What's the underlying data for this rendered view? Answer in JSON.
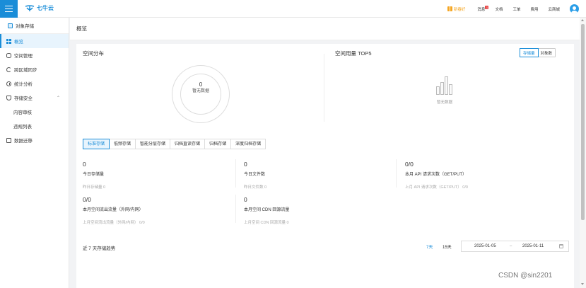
{
  "brand": {
    "name": "七牛云",
    "color": "#1a8dd8"
  },
  "topbar": {
    "promo_label": "新春好",
    "links": [
      {
        "label": "消息",
        "badge": "1"
      },
      {
        "label": "文档"
      },
      {
        "label": "工单"
      },
      {
        "label": "费用"
      },
      {
        "label": "云商城"
      }
    ]
  },
  "sidebar": {
    "header": "对象存储",
    "items": [
      {
        "label": "概览",
        "icon": "grid-icon",
        "active": true
      },
      {
        "label": "空间管理",
        "icon": "database-icon"
      },
      {
        "label": "跨区域同步",
        "icon": "sync-icon"
      },
      {
        "label": "统计分析",
        "icon": "clock-icon"
      },
      {
        "label": "存储安全",
        "icon": "shield-icon",
        "expanded": true
      },
      {
        "label": "内容审核",
        "sub": true
      },
      {
        "label": "违规列表",
        "sub": true
      },
      {
        "label": "数据迁移",
        "icon": "migrate-icon"
      }
    ]
  },
  "page": {
    "title": "概览"
  },
  "space_distribution": {
    "title": "空间分布",
    "value": "0",
    "empty_text": "暂无数据"
  },
  "top5": {
    "title": "空间用量 TOP5",
    "toggle": [
      "存储量",
      "对象数"
    ],
    "empty_text": "暂无数据"
  },
  "storage_tabs": [
    "标准存储",
    "低频存储",
    "智能分层存储",
    "归档直读存储",
    "归档存储",
    "深度归档存储"
  ],
  "stats": [
    {
      "value": "0",
      "label": "今日存储量",
      "sub": "昨日存储量 0"
    },
    {
      "value": "0",
      "label": "今日文件数",
      "sub": "昨日文件数 0"
    },
    {
      "value": "0/0",
      "label": "本月 API 请求次数（GET/PUT）",
      "sub": "上月 API 请求次数（GET/PUT） 0/0"
    },
    {
      "value": "0/0",
      "label": "本月空间流出流量（外网/内网）",
      "sub": "上月空间流出流量（外网/内网） 0/0"
    },
    {
      "value": "0",
      "label": "本月空间 CDN 回源流量",
      "sub": "上月空间 CDN 回源流量 0"
    }
  ],
  "trend": {
    "title": "近 7 天存储趋势",
    "ranges": [
      "7天",
      "15天"
    ],
    "start_date": "2025-01-05",
    "separator": "–",
    "end_date": "2025-01-11"
  },
  "watermark": "CSDN @sin2201"
}
